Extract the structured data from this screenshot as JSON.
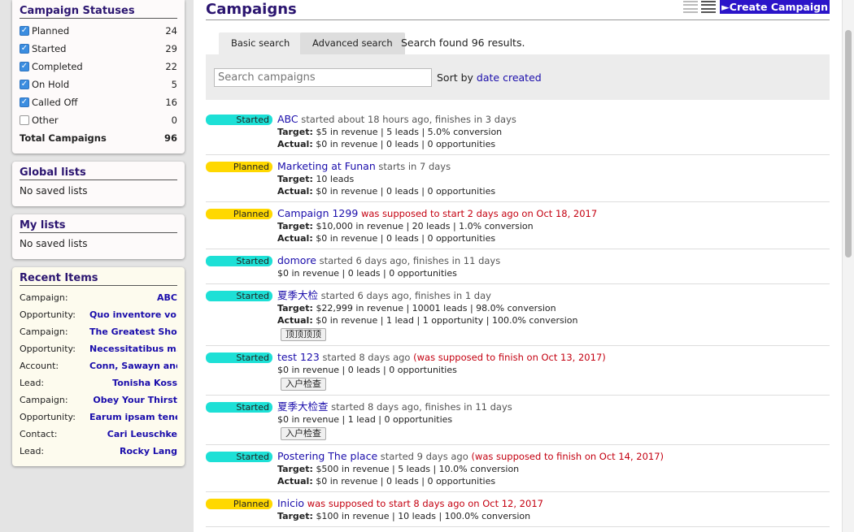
{
  "sidebar": {
    "statuses": {
      "title": "Campaign Statuses",
      "items": [
        {
          "label": "Planned",
          "count": "24",
          "checked": true
        },
        {
          "label": "Started",
          "count": "29",
          "checked": true
        },
        {
          "label": "Completed",
          "count": "22",
          "checked": true
        },
        {
          "label": "On Hold",
          "count": "5",
          "checked": true
        },
        {
          "label": "Called Off",
          "count": "16",
          "checked": true
        },
        {
          "label": "Other",
          "count": "0",
          "checked": false
        }
      ],
      "total_label": "Total Campaigns",
      "total_count": "96"
    },
    "global_lists": {
      "title": "Global lists",
      "empty": "No saved lists"
    },
    "my_lists": {
      "title": "My lists",
      "empty": "No saved lists"
    },
    "recent": {
      "title": "Recent Items",
      "items": [
        {
          "type": "Campaign:",
          "name": "ABC"
        },
        {
          "type": "Opportunity:",
          "name": "Quo inventore vo..."
        },
        {
          "type": "Campaign:",
          "name": "The Greatest Sho..."
        },
        {
          "type": "Opportunity:",
          "name": "Necessitatibus m..."
        },
        {
          "type": "Account:",
          "name": "Conn, Sawayn and..."
        },
        {
          "type": "Lead:",
          "name": "Tonisha Koss"
        },
        {
          "type": "Campaign:",
          "name": "Obey Your Thirst"
        },
        {
          "type": "Opportunity:",
          "name": "Earum ipsam tene..."
        },
        {
          "type": "Contact:",
          "name": "Cari Leuschke"
        },
        {
          "type": "Lead:",
          "name": "Rocky Lang"
        }
      ]
    }
  },
  "main": {
    "title": "Campaigns",
    "create_label": "Create Campaign",
    "create_icon": "triangle-right-icon",
    "tabs": [
      {
        "label": "Basic search"
      },
      {
        "label": "Advanced search"
      }
    ],
    "search_found": "Search found 96 results.",
    "search_placeholder": "Search campaigns",
    "sort_prefix": "Sort by",
    "sort_value": "date created"
  },
  "campaigns": [
    {
      "status": "Started",
      "name": "ABC",
      "desc": "started about 18 hours ago, finishes in 3 days",
      "late": "",
      "target": "$5 in revenue | 5 leads | 5.0% conversion",
      "actual": "$0 in revenue | 0 leads | 0 opportunities",
      "plain": "",
      "button": ""
    },
    {
      "status": "Planned",
      "name": "Marketing at Funan",
      "desc": "starts in 7 days",
      "late": "",
      "target": "10 leads",
      "actual": "$0 in revenue | 0 leads | 0 opportunities",
      "plain": "",
      "button": ""
    },
    {
      "status": "Planned",
      "name": "Campaign 1299",
      "desc": "",
      "late": "was supposed to start 2 days ago on Oct 18, 2017",
      "target": "$10,000 in revenue | 20 leads | 1.0% conversion",
      "actual": "$0 in revenue | 0 leads | 0 opportunities",
      "plain": "",
      "button": ""
    },
    {
      "status": "Started",
      "name": "domore",
      "desc": "started 6 days ago, finishes in 11 days",
      "late": "",
      "target": "",
      "actual": "",
      "plain": "$0 in revenue | 0 leads | 0 opportunities",
      "button": ""
    },
    {
      "status": "Started",
      "name": "夏季大检",
      "desc": "started 6 days ago, finishes in 1 day",
      "late": "",
      "target": "$22,999 in revenue | 10001 leads | 98.0% conversion",
      "actual": "$0 in revenue | 1 lead | 1 opportunity | 100.0% conversion",
      "plain": "",
      "button": "顶顶顶顶"
    },
    {
      "status": "Started",
      "name": "test 123",
      "desc": "started 8 days ago",
      "late": "(was supposed to finish on Oct 13, 2017)",
      "target": "",
      "actual": "",
      "plain": "$0 in revenue | 0 leads | 0 opportunities",
      "button": "入户检查"
    },
    {
      "status": "Started",
      "name": "夏季大检查",
      "desc": "started 8 days ago, finishes in 11 days",
      "late": "",
      "target": "",
      "actual": "",
      "plain": "$0 in revenue | 1 lead | 0 opportunities",
      "button": "入户检查"
    },
    {
      "status": "Started",
      "name": "Postering The place",
      "desc": "started 9 days ago",
      "late": "(was supposed to finish on Oct 14, 2017)",
      "target": "$500 in revenue | 5 leads | 10.0% conversion",
      "actual": "$0 in revenue | 0 leads | 0 opportunities",
      "plain": "",
      "button": ""
    },
    {
      "status": "Planned",
      "name": "Inicio",
      "desc": "",
      "late": "was supposed to start 8 days ago on Oct 12, 2017",
      "target": "$100 in revenue | 10 leads | 100.0% conversion",
      "actual": "",
      "plain": "",
      "button": ""
    }
  ],
  "labels": {
    "target": "Target:",
    "actual": "Actual:"
  },
  "colors": {
    "title": "#2b1570",
    "link": "#1a0dab",
    "started": "#1de0d6",
    "planned": "#ffd800",
    "late": "#c40010",
    "create_btn": "#2b14c9"
  }
}
